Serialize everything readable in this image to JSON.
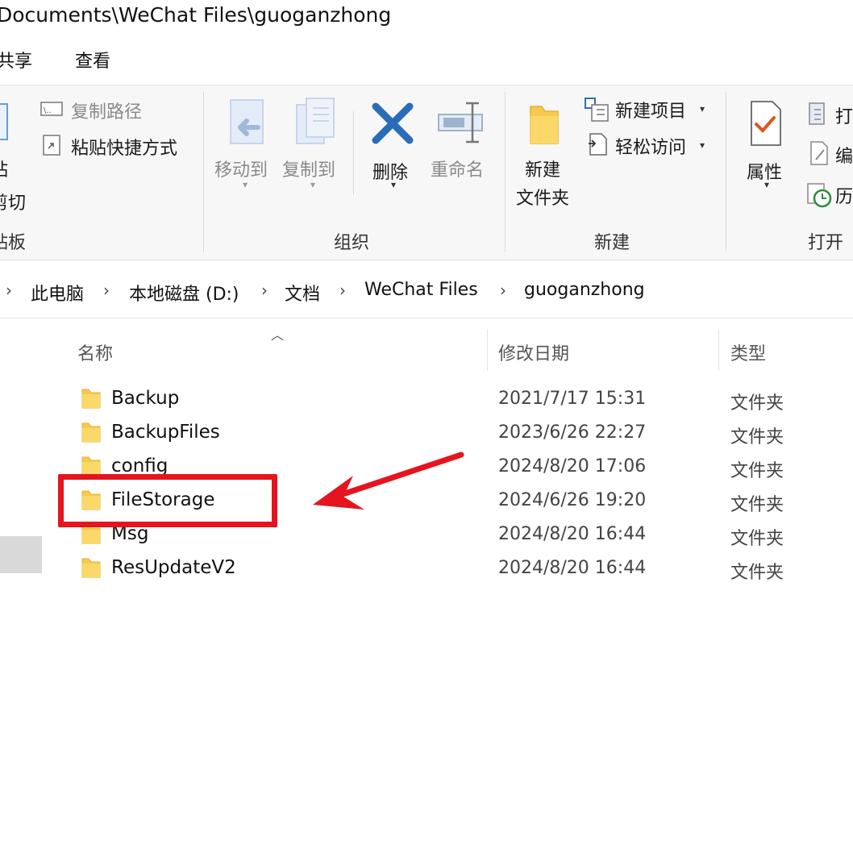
{
  "window": {
    "title": "Documents\\WeChat Files\\guoganzhong"
  },
  "ribbon_tabs": [
    "共享",
    "查看"
  ],
  "ribbon": {
    "clipboard": {
      "paste_fragment": "粘",
      "cut_fragment": "剪切",
      "group_label_fragment": "贴板",
      "copy_path": "复制路径",
      "paste_shortcut": "粘贴快捷方式"
    },
    "organize": {
      "move_to": "移动到",
      "copy_to": "复制到",
      "delete": "删除",
      "rename": "重命名",
      "group_label": "组织"
    },
    "new": {
      "new_folder_line1": "新建",
      "new_folder_line2": "文件夹",
      "new_item": "新建项目",
      "easy_access": "轻松访问",
      "group_label": "新建"
    },
    "open": {
      "properties": "属性",
      "open_fragment": "打",
      "edit_fragment": "编",
      "history_fragment": "历",
      "group_label": "打开"
    }
  },
  "breadcrumb": [
    "此电脑",
    "本地磁盘 (D:)",
    "文档",
    "WeChat Files",
    "guoganzhong"
  ],
  "columns": {
    "name": "名称",
    "modified": "修改日期",
    "type": "类型"
  },
  "files": [
    {
      "name": "Backup",
      "modified": "2021/7/17 15:31",
      "type": "文件夹"
    },
    {
      "name": "BackupFiles",
      "modified": "2023/6/26 22:27",
      "type": "文件夹"
    },
    {
      "name": "config",
      "modified": "2024/8/20 17:06",
      "type": "文件夹"
    },
    {
      "name": "FileStorage",
      "modified": "2024/6/26 19:20",
      "type": "文件夹"
    },
    {
      "name": "Msg",
      "modified": "2024/8/20 16:44",
      "type": "文件夹"
    },
    {
      "name": "ResUpdateV2",
      "modified": "2024/8/20 16:44",
      "type": "文件夹"
    }
  ],
  "annotation": {
    "highlighted_item": "FileStorage",
    "color": "#e4151e"
  },
  "colors": {
    "folder": "#f6c94f",
    "folder_dark": "#e5b23a",
    "delete_x": "#2b6cb8",
    "ribbon_bg": "#f7f7f7"
  }
}
